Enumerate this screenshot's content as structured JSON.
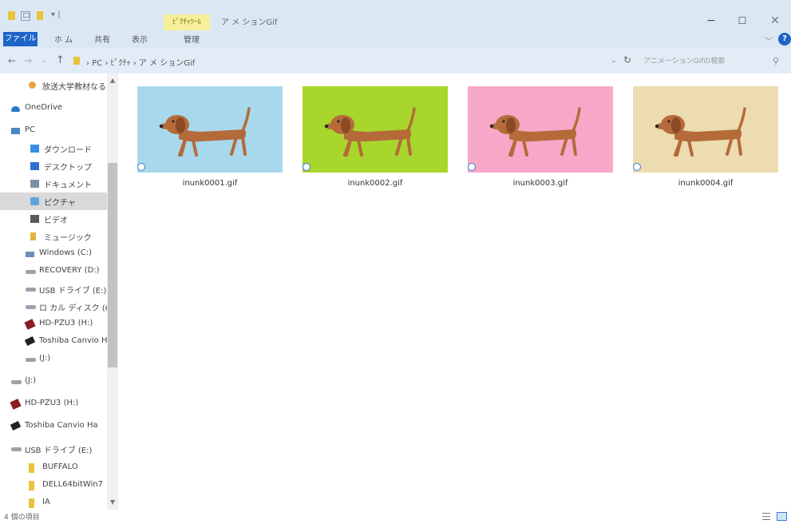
{
  "window": {
    "title": "ア メ ションGif",
    "context_tab_group": "ﾋﾟｸﾁｬﾂｰﾙ",
    "controls": {
      "minimize": "−",
      "maximize": "☐",
      "close": "✕"
    },
    "qat_dropdown": "▾ |"
  },
  "ribbon": {
    "tabs": {
      "file": "ファイル",
      "home": "ホ ム",
      "share": "共有",
      "view": "表示",
      "manage": "管理"
    },
    "expand": "﹀",
    "help": "?"
  },
  "address": {
    "breadcrumb": "›  PC  ›  ﾋﾟｸﾁｬ  ›  ア メ ションGif",
    "nav_back": "←",
    "nav_forward": "→",
    "nav_recent": "⌄",
    "nav_up": "↑",
    "dropdown": "⌄",
    "refresh": "↻"
  },
  "search": {
    "placeholder": "アニメーションGifの検索",
    "icon": "search-icon"
  },
  "sidebar": {
    "items": [
      {
        "label": "放送大学教材なる",
        "icon": "gear"
      },
      {
        "label": "OneDrive",
        "icon": "onedrive"
      },
      {
        "label": "PC",
        "icon": "pc"
      },
      {
        "label": "ダウンロード",
        "icon": "download"
      },
      {
        "label": "デスクトップ",
        "icon": "desktop"
      },
      {
        "label": "ドキュメント",
        "icon": "documents"
      },
      {
        "label": "ピクチャ",
        "icon": "pictures"
      },
      {
        "label": "ビデオ",
        "icon": "video"
      },
      {
        "label": "ミュージック",
        "icon": "music"
      },
      {
        "label": "Windows (C:)",
        "icon": "windows-drive"
      },
      {
        "label": "RECOVERY (D:)",
        "icon": "drive"
      },
      {
        "label": "USB ドライブ (E:)",
        "icon": "drive"
      },
      {
        "label": "ロ カル ディスク (G",
        "icon": "drive"
      },
      {
        "label": "HD-PZU3 (H:)",
        "icon": "hd"
      },
      {
        "label": "Toshiba Canvio H",
        "icon": "toshiba"
      },
      {
        "label": "(J:)",
        "icon": "drive"
      },
      {
        "label": "(J:)",
        "icon": "drive"
      },
      {
        "label": "HD-PZU3 (H:)",
        "icon": "hd"
      },
      {
        "label": "Toshiba Canvio Ha",
        "icon": "toshiba"
      },
      {
        "label": "USB ドライブ (E:)",
        "icon": "drive"
      },
      {
        "label": "BUFFALO",
        "icon": "folder"
      },
      {
        "label": "DELL64bitWin7",
        "icon": "folder"
      },
      {
        "label": "IA",
        "icon": "folder"
      }
    ],
    "selected_index": 6,
    "scroll_up": "▲",
    "scroll_down": "▼"
  },
  "files": [
    {
      "name": "inunk0001.gif",
      "bg": "#a7d8eb"
    },
    {
      "name": "inunk0002.gif",
      "bg": "#a8d62c"
    },
    {
      "name": "inunk0003.gif",
      "bg": "#f7a8c8"
    },
    {
      "name": "inunk0004.gif",
      "bg": "#ecdcb0"
    }
  ],
  "dog_color": "#b56a3a",
  "status": {
    "item_count": "4 個の項目"
  }
}
